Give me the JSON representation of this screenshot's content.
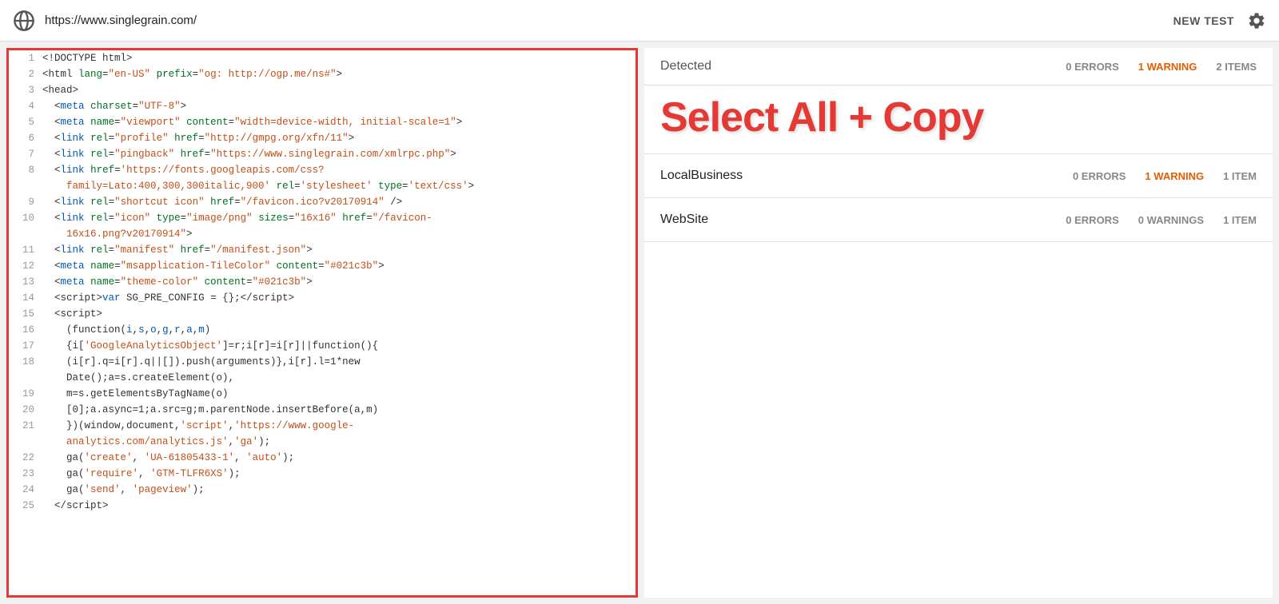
{
  "topbar": {
    "url": "https://www.singlegrain.com/",
    "new_test_label": "NEW TEST"
  },
  "right_panel": {
    "detected_label": "Detected",
    "header_stats": {
      "errors": "0 ERRORS",
      "warnings": "1 WARNING",
      "items": "2 ITEMS"
    },
    "select_all_label": "Select All + Copy",
    "items": [
      {
        "name": "LocalBusiness",
        "errors": "0 ERRORS",
        "warnings": "1 WARNING",
        "warnings_type": "orange",
        "items": "1 ITEM"
      },
      {
        "name": "WebSite",
        "errors": "0 ERRORS",
        "warnings": "0 WARNINGS",
        "warnings_type": "gray",
        "items": "1 ITEM"
      }
    ]
  },
  "code_lines": [
    {
      "num": 1,
      "html": "&lt;!DOCTYPE html&gt;"
    },
    {
      "num": 2,
      "html": "&lt;html <span class=\"attr\">lang</span>=<span class=\"val\">\"en-US\"</span> <span class=\"attr\">prefix</span>=<span class=\"val\">\"og: http://ogp.me/ns#\"</span>&gt;"
    },
    {
      "num": 3,
      "html": "&lt;head&gt;"
    },
    {
      "num": 4,
      "html": "  &lt;<span class=\"tag\">meta</span> <span class=\"attr\">charset</span>=<span class=\"val\">\"UTF-8\"</span>&gt;"
    },
    {
      "num": 5,
      "html": "  &lt;<span class=\"tag\">meta</span> <span class=\"attr\">name</span>=<span class=\"val\">\"viewport\"</span> <span class=\"attr\">content</span>=<span class=\"val\">\"width=device-width, initial-scale=1\"</span>&gt;"
    },
    {
      "num": 6,
      "html": "  &lt;<span class=\"tag\">link</span> <span class=\"attr\">rel</span>=<span class=\"val\">\"profile\"</span> <span class=\"attr\">href</span>=<span class=\"val\">\"http://gmpg.org/xfn/11\"</span>&gt;"
    },
    {
      "num": 7,
      "html": "  &lt;<span class=\"tag\">link</span> <span class=\"attr\">rel</span>=<span class=\"val\">\"pingback\"</span> <span class=\"attr\">href</span>=<span class=\"val\">\"https://www.singlegrain.com/xmlrpc.php\"</span>&gt;"
    },
    {
      "num": 8,
      "html": "  &lt;<span class=\"tag\">link</span> <span class=\"attr\">href</span>=<span class=\"val\">'https://fonts.googleapis.com/css?<br>&nbsp;&nbsp;&nbsp;&nbsp;family=Lato:400,300,300italic,900'</span> <span class=\"attr\">rel</span>=<span class=\"val\">'stylesheet'</span> <span class=\"attr\">type</span>=<span class=\"val\">'text/css'</span>&gt;"
    },
    {
      "num": 9,
      "html": "  &lt;<span class=\"tag\">link</span> <span class=\"attr\">rel</span>=<span class=\"val\">\"shortcut icon\"</span> <span class=\"attr\">href</span>=<span class=\"val\">\"/favicon.ico?v20170914\"</span> /&gt;"
    },
    {
      "num": 10,
      "html": "  &lt;<span class=\"tag\">link</span> <span class=\"attr\">rel</span>=<span class=\"val\">\"icon\"</span> <span class=\"attr\">type</span>=<span class=\"val\">\"image/png\"</span> <span class=\"attr\">sizes</span>=<span class=\"val\">\"16x16\"</span> <span class=\"attr\">href</span>=<span class=\"val\">\"/favicon-<br>&nbsp;&nbsp;&nbsp;&nbsp;16x16.png?v20170914\"</span>&gt;"
    },
    {
      "num": 11,
      "html": "  &lt;<span class=\"tag\">link</span> <span class=\"attr\">rel</span>=<span class=\"val\">\"manifest\"</span> <span class=\"attr\">href</span>=<span class=\"val\">\"/manifest.json\"</span>&gt;"
    },
    {
      "num": 12,
      "html": "  &lt;<span class=\"tag\">meta</span> <span class=\"attr\">name</span>=<span class=\"val\">\"msapplication-TileColor\"</span> <span class=\"attr\">content</span>=<span class=\"val\">\"#021c3b\"</span>&gt;"
    },
    {
      "num": 13,
      "html": "  &lt;<span class=\"tag\">meta</span> <span class=\"attr\">name</span>=<span class=\"val\">\"theme-color\"</span> <span class=\"attr\">content</span>=<span class=\"val\">\"#021c3b\"</span>&gt;"
    },
    {
      "num": 14,
      "html": "  &lt;script&gt;<span class=\"js-kw\">var</span> SG_PRE_CONFIG = {};&lt;/script&gt;"
    },
    {
      "num": 15,
      "html": "  &lt;script&gt;"
    },
    {
      "num": 16,
      "html": "    (function(<span class=\"js-kw\">i</span>,<span class=\"js-kw\">s</span>,<span class=\"js-kw\">o</span>,<span class=\"js-kw\">g</span>,<span class=\"js-kw\">r</span>,<span class=\"js-kw\">a</span>,<span class=\"js-kw\">m</span>)"
    },
    {
      "num": 17,
      "html": "    {i[<span class=\"val\">'GoogleAnalyticsObject'</span>]=r;i[r]=i[r]||function(){"
    },
    {
      "num": 18,
      "html": "    (i[r].q=i[r].q||[]).push(arguments)},i[r].l=1*new<br>&nbsp;&nbsp;&nbsp;&nbsp;Date();a=s.createElement(o),"
    },
    {
      "num": 19,
      "html": "    m=s.getElementsByTagName(o)"
    },
    {
      "num": 20,
      "html": "    [0];a.async=1;a.src=g;m.parentNode.insertBefore(a,m)"
    },
    {
      "num": 21,
      "html": "    })(window,document,<span class=\"val\">'script'</span>,<span class=\"val\">'https://www.google-<br>&nbsp;&nbsp;&nbsp;&nbsp;analytics.com/analytics.js'</span>,<span class=\"val\">'ga'</span>);"
    },
    {
      "num": 22,
      "html": "    ga(<span class=\"val\">'create'</span>, <span class=\"val\">'UA-61805433-1'</span>, <span class=\"val\">'auto'</span>);"
    },
    {
      "num": 23,
      "html": "    ga(<span class=\"val\">'require'</span>, <span class=\"val\">'GTM-TLFR6XS'</span>);"
    },
    {
      "num": 24,
      "html": "    ga(<span class=\"val\">'send'</span>, <span class=\"val\">'pageview'</span>);"
    },
    {
      "num": 25,
      "html": "  &lt;/script&gt;"
    }
  ]
}
